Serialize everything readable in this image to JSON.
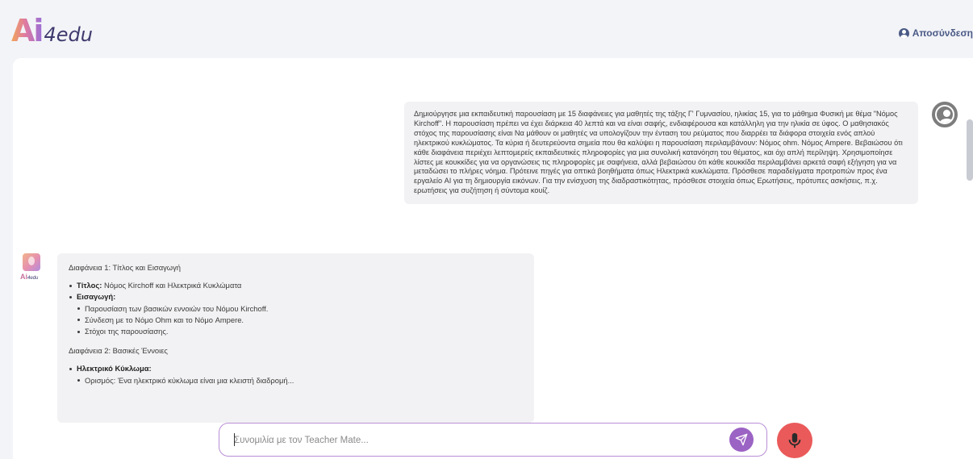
{
  "header": {
    "logo_main": "Ai",
    "logo_sub": "4edu",
    "logout_label": "Αποσύνδεση"
  },
  "user_message": {
    "text": "Δημιούργησε μια εκπαιδευτική παρουσίαση με 15 διαφάνειες για μαθητές της τάξης Γ' Γυμνασίου, ηλικίας 15, για το μάθημα Φυσική με θέμα \"Νόμος Kirchoff\". Η παρουσίαση πρέπει να έχει διάρκεια 40 λεπτά και να είναι σαφής, ενδιαφέρουσα και κατάλληλη για την ηλικία σε ύφος. Ο μαθησιακός στόχος της παρουσίασης είναι Να μάθουν οι μαθητές να υπολογίζουν την ένταση του ρεύματος που διαρρέει τα διάφορα στοιχεία ενός απλού ηλεκτρικού κυκλώματος. Τα κύρια ή δευτερεύοντα σημεία που θα καλύψει η παρουσίαση περιλαμβάνουν: Νόμος ohm. Νόμος Ampere. Βεβαιώσου ότι κάθε διαφάνεια περιέχει λεπτομερείς εκπαιδευτικές πληροφορίες για μια συνολική κατανόηση του θέματος, και όχι απλή περίληψη. Χρησιμοποίησε λίστες με κουκκίδες για να οργανώσεις τις πληροφορίες με σαφήνεια, αλλά βεβαιώσου ότι κάθε κουκκίδα περιλαμβάνει αρκετά σαφή εξήγηση για να μεταδώσει το πλήρες νόημα. Πρότεινε πηγές για οπτικά βοηθήματα όπως Ηλεκτρικά κυκλώματα. Πρόσθεσε παραδείγματα προτροπών προς ένα εργαλείο AI για τη δημιουργία εικόνων. Για την ενίσχυση της διαδραστικότητας, πρόσθεσε στοιχεία όπως Ερωτήσεις, πρότυπες ασκήσεις, π.χ. ερωτήσεις για συζήτηση ή σύντομα κουίζ."
  },
  "bot_avatar": {
    "label_main": "Ai",
    "label_sub": "4edu"
  },
  "bot_message": {
    "slide1_title": "Διαφάνεια 1: Τίτλος και Εισαγωγή",
    "slide1_items": [
      {
        "label": "Τίτλος:",
        "text": " Νόμος Kirchoff και Ηλεκτρικά Κυκλώματα"
      },
      {
        "label": "Εισαγωγή:",
        "text": ""
      }
    ],
    "slide1_sub": [
      "Παρουσίαση των βασικών εννοιών του Νόμου Kirchoff.",
      "Σύνδεση με το Νόμο Ohm και το Νόμο Ampere.",
      "Στόχοι της παρουσίασης."
    ],
    "slide2_title": "Διαφάνεια 2: Βασικές Έννοιες",
    "slide2_item": "Ηλεκτρικό Κύκλωμα:",
    "slide2_sub_partial": "Ορισμός: Ένα ηλεκτρικό κύκλωμα είναι μια κλειστή διαδρομή..."
  },
  "composer": {
    "placeholder": "Συνομιλία με τον Teacher Mate..."
  },
  "colors": {
    "accent_purple": "#9b63c4",
    "mic_red": "#ea5a5a",
    "logout_blue": "#4a5a86"
  },
  "icons": {
    "logout": "user-circle-icon",
    "send": "paper-plane-icon",
    "mic": "microphone-icon"
  }
}
